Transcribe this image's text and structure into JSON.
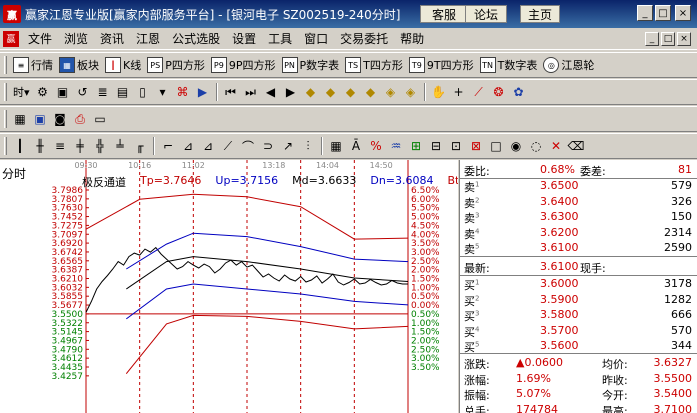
{
  "window": {
    "title": "赢家江恩专业版[赢家内部服务平台] - [银河电子  SZ002519-240分时]",
    "links": [
      "客服",
      "论坛",
      "主页"
    ]
  },
  "menu": [
    "文件",
    "浏览",
    "资讯",
    "江恩",
    "公式选股",
    "设置",
    "工具",
    "窗口",
    "交易委托",
    "帮助"
  ],
  "toolbar1": [
    {
      "icon": "quote-list-icon",
      "label": "行情"
    },
    {
      "icon": "sector-icon",
      "label": "板块"
    },
    {
      "icon": "kline-icon",
      "label": "K线"
    },
    {
      "icon": "p-square-icon",
      "icon_text": "PS",
      "label": "P四方形"
    },
    {
      "icon": "9p-square-icon",
      "icon_text": "P9",
      "label": "9P四方形"
    },
    {
      "icon": "p-number-icon",
      "icon_text": "PN",
      "label": "P数字表"
    },
    {
      "icon": "t-square-icon",
      "icon_text": "TS",
      "label": "T四方形"
    },
    {
      "icon": "9t-square-icon",
      "icon_text": "T9",
      "label": "9T四方形"
    },
    {
      "icon": "t-number-icon",
      "icon_text": "TN",
      "label": "T数字表"
    },
    {
      "icon": "gann-wheel-icon",
      "label": "江恩轮"
    }
  ],
  "toolbar2": {
    "period_label": "时"
  },
  "chart": {
    "period_label": "分时",
    "indicator_name": "极反通道",
    "indicators": [
      {
        "label": "Tp=3.7646",
        "color": "#c00000"
      },
      {
        "label": "Up=3.7156",
        "color": "#0000c0"
      },
      {
        "label": "Md=3.6633",
        "color": "#000000"
      },
      {
        "label": "Dn=3.6084",
        "color": "#0000c0"
      },
      {
        "label": "Bt=3.5594",
        "color": "#c00000"
      }
    ],
    "time_labels": [
      "09:30",
      "10:16",
      "11:02",
      "13:18",
      "14:04",
      "14:50"
    ],
    "price_labels": [
      "3.7986",
      "3.7807",
      "3.7630",
      "3.7452",
      "3.7275",
      "3.7097",
      "3.6920",
      "3.6742",
      "3.6565",
      "3.6387",
      "3.6210",
      "3.6032",
      "3.5855",
      "3.5677",
      "3.5500",
      "3.5322",
      "3.5145",
      "3.4967",
      "3.4790",
      "3.4612",
      "3.4435",
      "3.4257"
    ],
    "pct_labels": [
      "6.50%",
      "6.00%",
      "5.50%",
      "5.00%",
      "4.50%",
      "4.00%",
      "3.50%",
      "3.00%",
      "2.50%",
      "2.00%",
      "1.50%",
      "1.00%",
      "0.50%",
      "0.00%",
      "0.50%",
      "1.00%",
      "1.50%",
      "2.00%",
      "2.50%",
      "3.00%",
      "3.50%"
    ]
  },
  "chart_data": {
    "type": "line",
    "x": [
      0,
      4,
      8,
      12,
      16,
      20,
      24,
      28,
      32,
      36,
      40,
      44,
      48,
      52,
      56,
      60,
      64,
      68,
      72,
      76,
      80,
      84,
      88,
      92,
      96,
      100,
      104,
      108,
      112,
      116,
      120,
      124,
      128,
      132,
      136,
      140,
      144,
      148,
      152,
      156,
      160,
      164,
      168,
      172,
      176,
      180,
      184,
      188,
      192,
      196,
      200,
      204,
      208,
      212,
      216,
      220,
      224,
      228,
      232,
      236,
      240
    ],
    "ylim": [
      3.4257,
      3.7986
    ],
    "series": [
      {
        "values": [
          3.553,
          3.575,
          3.6,
          3.615,
          3.627,
          3.64,
          3.655,
          3.648,
          3.665,
          3.672,
          3.668,
          3.68,
          3.674,
          3.683,
          3.67,
          3.66,
          3.65,
          3.64,
          3.645,
          3.655,
          3.648,
          3.642,
          3.65,
          3.645,
          3.632,
          3.64,
          3.652,
          3.658,
          3.648,
          3.655,
          3.644,
          3.648,
          3.636,
          3.624,
          3.63,
          3.622,
          3.616,
          3.628,
          3.62,
          3.616,
          3.625,
          3.614,
          3.618,
          3.626,
          3.612,
          3.62,
          3.63,
          3.614,
          3.608,
          3.613,
          3.62,
          3.61,
          3.612,
          3.619,
          3.613,
          3.608,
          3.61,
          3.617,
          3.612,
          3.61,
          3.61
        ]
      }
    ]
  },
  "quote": {
    "weibi_label": "委比:",
    "weibi": "0.68%",
    "weicha_label": "委差:",
    "weicha": "81",
    "sell_label": "卖",
    "sells": [
      {
        "price": "3.6500",
        "vol": "579"
      },
      {
        "price": "3.6400",
        "vol": "326"
      },
      {
        "price": "3.6300",
        "vol": "150"
      },
      {
        "price": "3.6200",
        "vol": "2314"
      },
      {
        "price": "3.6100",
        "vol": "2590"
      }
    ],
    "latest_label": "最新:",
    "latest": "3.6100",
    "xianshou_label": "现手:",
    "buy_label": "买",
    "buys": [
      {
        "price": "3.6000",
        "vol": "3178"
      },
      {
        "price": "3.5900",
        "vol": "1282"
      },
      {
        "price": "3.5800",
        "vol": "666"
      },
      {
        "price": "3.5700",
        "vol": "570"
      },
      {
        "price": "3.5600",
        "vol": "344"
      }
    ],
    "stats": [
      {
        "l1": "涨跌:",
        "v1": "▲0.0600",
        "l2": "均价:",
        "v2": "3.6327"
      },
      {
        "l1": "涨幅:",
        "v1": "1.69%",
        "l2": "昨收:",
        "v2": "3.5500"
      },
      {
        "l1": "振幅:",
        "v1": "5.07%",
        "l2": "今开:",
        "v2": "3.5400"
      },
      {
        "l1": "总手:",
        "v1": "174784",
        "l2": "最高:",
        "v2": "3.7100"
      }
    ]
  }
}
